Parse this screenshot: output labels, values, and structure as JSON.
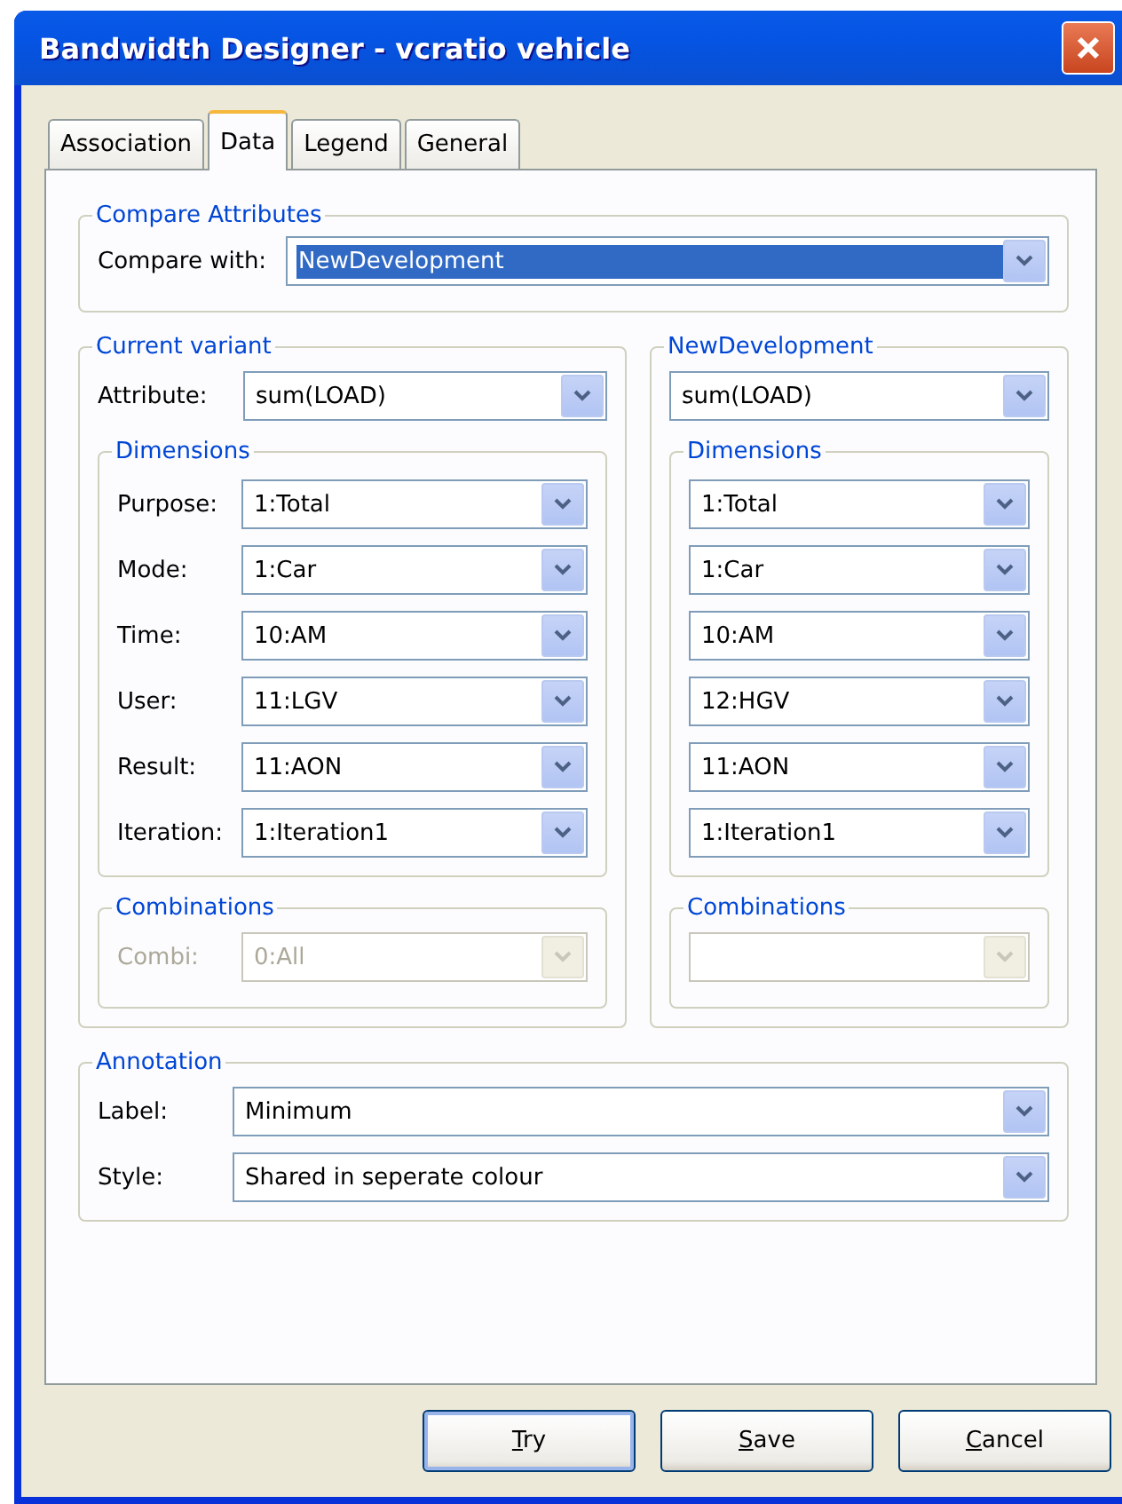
{
  "window": {
    "title": "Bandwidth Designer - vcratio vehicle"
  },
  "tabs": [
    {
      "label": "Association",
      "selected": false
    },
    {
      "label": "Data",
      "selected": true
    },
    {
      "label": "Legend",
      "selected": false
    },
    {
      "label": "General",
      "selected": false
    }
  ],
  "compare_attributes": {
    "title": "Compare Attributes",
    "label": "Compare with:",
    "value": "NewDevelopment",
    "focused": true
  },
  "variants": [
    {
      "title": "Current variant",
      "attribute": {
        "label": "Attribute:",
        "value": "sum(LOAD)"
      },
      "dimensions": {
        "title": "Dimensions",
        "rows": [
          {
            "label": "Purpose:",
            "value": "1:Total"
          },
          {
            "label": "Mode:",
            "value": "1:Car"
          },
          {
            "label": "Time:",
            "value": "10:AM"
          },
          {
            "label": "User:",
            "value": "11:LGV"
          },
          {
            "label": "Result:",
            "value": "11:AON"
          },
          {
            "label": "Iteration:",
            "value": "1:Iteration1"
          }
        ]
      },
      "combinations": {
        "title": "Combinations",
        "label": "Combi:",
        "value": "0:All",
        "disabled": true
      }
    },
    {
      "title": "NewDevelopment",
      "attribute": {
        "value": "sum(LOAD)"
      },
      "dimensions": {
        "title": "Dimensions",
        "rows": [
          {
            "value": "1:Total"
          },
          {
            "value": "1:Car"
          },
          {
            "value": "10:AM"
          },
          {
            "value": "12:HGV"
          },
          {
            "value": "11:AON"
          },
          {
            "value": "1:Iteration1"
          }
        ]
      },
      "combinations": {
        "title": "Combinations",
        "disabled": true
      }
    }
  ],
  "annotation": {
    "title": "Annotation",
    "rows": [
      {
        "label": "Label:",
        "value": "Minimum"
      },
      {
        "label": "Style:",
        "value": "Shared in seperate colour"
      }
    ]
  },
  "buttons": [
    {
      "label": [
        {
          "text": "T",
          "underlined": true
        },
        {
          "text": "ry",
          "underlined": false
        }
      ],
      "default": true
    },
    {
      "label": [
        {
          "text": "S",
          "underlined": true
        },
        {
          "text": "ave",
          "underlined": false
        }
      ],
      "default": false
    },
    {
      "label": [
        {
          "text": "C",
          "underlined": true
        },
        {
          "text": "ancel",
          "underlined": false
        }
      ],
      "default": false
    }
  ]
}
